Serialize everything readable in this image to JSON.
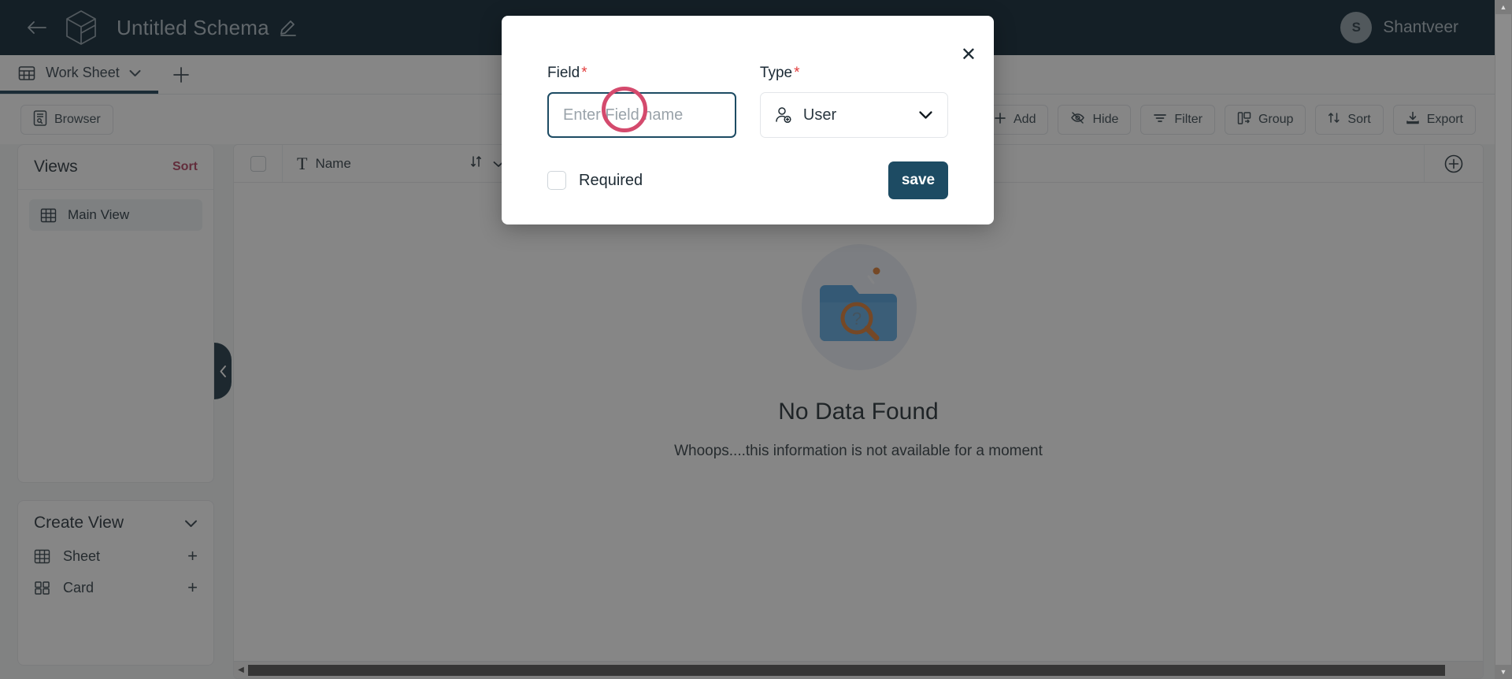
{
  "header": {
    "back_icon": "arrow-left-icon",
    "logo_icon": "cube-logo-icon",
    "schema_title": "Untitled Schema",
    "edit_icon": "pencil-icon",
    "user": {
      "initial": "S",
      "name": "Shantveer"
    }
  },
  "tabs": {
    "items": [
      {
        "icon": "grid-icon",
        "label": "Work Sheet",
        "caret": "chevron-down-icon",
        "active": true
      }
    ],
    "add_label": "+"
  },
  "toolbar": {
    "left": [
      {
        "icon": "browser-icon",
        "label": "Browser"
      }
    ],
    "right": [
      {
        "icon": "plus-icon",
        "label": "Add"
      },
      {
        "icon": "eye-off-icon",
        "label": "Hide"
      },
      {
        "icon": "filter-icon",
        "label": "Filter"
      },
      {
        "icon": "group-icon",
        "label": "Group"
      },
      {
        "icon": "sort-icon",
        "label": "Sort"
      },
      {
        "icon": "export-icon",
        "label": "Export"
      }
    ]
  },
  "sidebar": {
    "views": {
      "title": "Views",
      "sort_label": "Sort",
      "items": [
        {
          "icon": "grid-icon",
          "label": "Main View",
          "selected": true
        }
      ]
    },
    "create_view": {
      "title": "Create View",
      "caret": "chevron-down-icon",
      "items": [
        {
          "icon": "sheet-icon",
          "label": "Sheet",
          "action": "+"
        },
        {
          "icon": "card-icon",
          "label": "Card",
          "action": "+"
        }
      ]
    },
    "collapse_handle": "chevron-left-icon"
  },
  "grid": {
    "columns": [
      {
        "type_icon": "text-type-icon",
        "label": "Name",
        "sort_icon": "sort-icon",
        "menu_icon": "chevron-down-icon"
      }
    ],
    "select_all_checkbox": false,
    "add_column_icon": "plus-circle-icon",
    "rows": [],
    "empty_state": {
      "illustration": "folder-search-icon",
      "title": "No Data Found",
      "subtitle": "Whoops....this information is not available for a moment"
    }
  },
  "modal": {
    "close_icon": "close-icon",
    "field": {
      "label": "Field",
      "required_marker": "*",
      "value": "",
      "placeholder": "Enter Field name"
    },
    "type": {
      "label": "Type",
      "required_marker": "*",
      "icon": "user-add-icon",
      "selected": "User",
      "caret": "chevron-down-icon",
      "options": [
        "User"
      ]
    },
    "required_checkbox": {
      "label": "Required",
      "checked": false
    },
    "save_button": "save"
  },
  "colors": {
    "header_bg": "#041c2b",
    "accent_dark": "#1d4b63",
    "required_red": "#e23c3c",
    "sort_link": "#b03a5b",
    "cursor_ring": "#d44a6d"
  },
  "scrollbars": {
    "horizontal_left_arrow": "◀",
    "vertical_up_arrow": "▲",
    "vertical_down_arrow": "▼"
  }
}
